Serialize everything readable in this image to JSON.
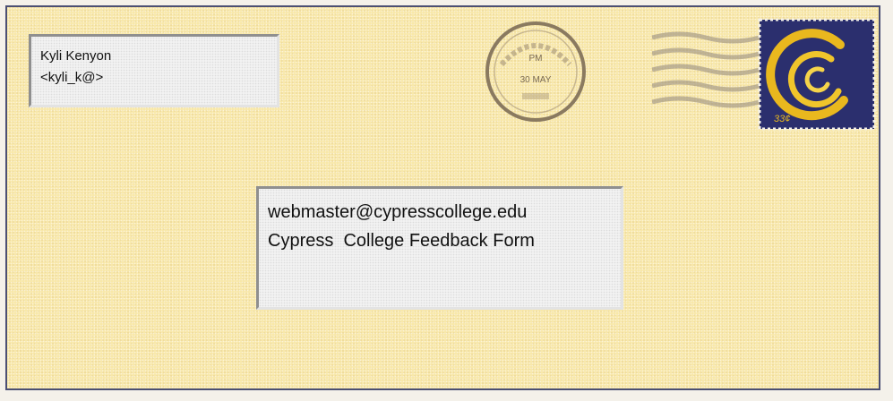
{
  "sender": {
    "name": "Kyli Kenyon",
    "email": "<kyli_k@>"
  },
  "recipient": {
    "email": "webmaster@cypresscollege.edu",
    "subject": "Cypress  College Feedback Form"
  },
  "postmark": {
    "time": "PM",
    "date": "30 MAY"
  },
  "stamp": {
    "denomination": "33¢"
  },
  "colors": {
    "envelope": "#f8e7a6",
    "border": "#4b4f73",
    "stamp_bg": "#2b2f6e",
    "stamp_swirl": "#e9b81e"
  }
}
